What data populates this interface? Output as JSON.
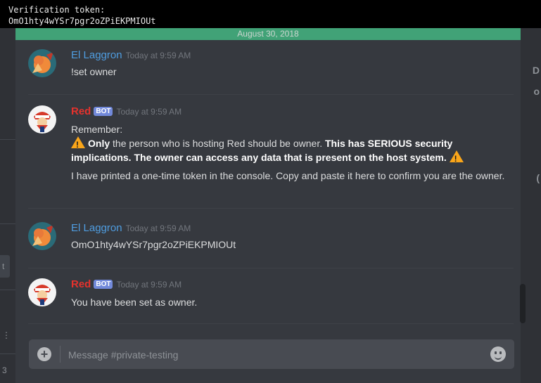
{
  "console": {
    "heading": "Verification token:",
    "token": "OmO1hty4wYSr7pgr2oZPiEKPMIOUt"
  },
  "date_divider": "August 30, 2018",
  "messages": [
    {
      "author": "El Laggron",
      "timestamp": "Today at 9:59 AM",
      "text": "!set owner"
    },
    {
      "author": "Red",
      "bot_tag": "BOT",
      "timestamp": "Today at 9:59 AM",
      "line1": "Remember:",
      "only": "Only",
      "mid": " the person who is hosting Red should be owner. ",
      "serious": "This has SERIOUS security implications. The owner can access any data that is present on the host system.",
      "line3": "I have printed a one-time token in the console. Copy and paste it here to confirm you are the owner."
    },
    {
      "author": "El Laggron",
      "timestamp": "Today at 9:59 AM",
      "text": "OmO1hty4wYSr7pgr2oZPiEKPMIOUt"
    },
    {
      "author": "Red",
      "bot_tag": "BOT",
      "timestamp": "Today at 9:59 AM",
      "text": "You have been set as owner."
    }
  ],
  "composer": {
    "placeholder": "Message #private-testing"
  },
  "icons": [
    "add-attachment-icon",
    "emoji-icon",
    "warning-icon"
  ]
}
